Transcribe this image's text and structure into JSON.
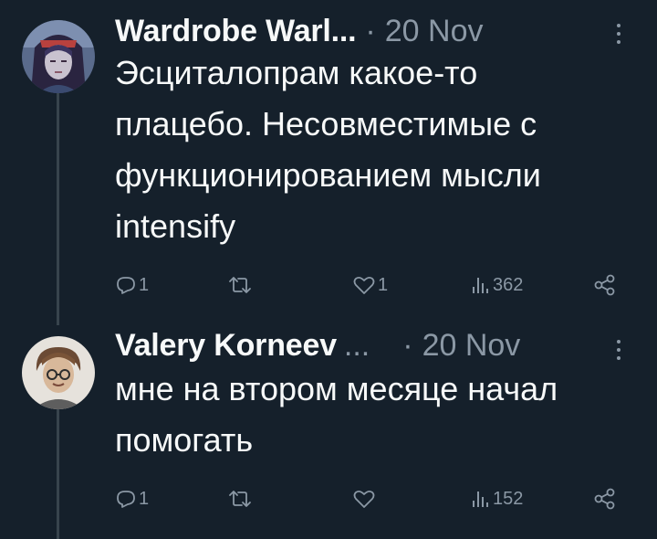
{
  "tweets": [
    {
      "author": "Wardrobe Warl...",
      "separator": "·",
      "date": "20 Nov",
      "lines": [
        "Эсциталопрам какое-то",
        "плацебо. Несовместимые с",
        "функционированием мысли",
        "intensify"
      ],
      "replies": "1",
      "reposts": "",
      "likes": "1",
      "views": "362"
    },
    {
      "author": "Valery Korneev",
      "ellipsis": "...",
      "separator": "·",
      "date": "20 Nov",
      "lines": [
        "мне на втором месяце начал",
        "помогать"
      ],
      "replies": "1",
      "reposts": "",
      "likes": "",
      "views": "152"
    }
  ],
  "colors": {
    "background": "#15202b",
    "text": "#f7f9f9",
    "secondary": "#8b98a5",
    "thread_line": "#38444d"
  },
  "icons": [
    "reply-icon",
    "repost-icon",
    "like-icon",
    "views-icon",
    "share-icon",
    "more-icon"
  ]
}
